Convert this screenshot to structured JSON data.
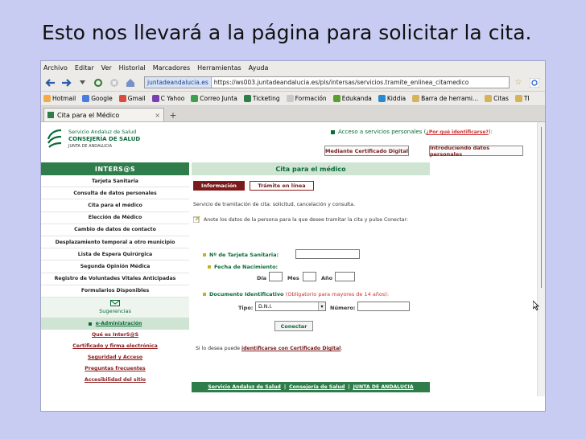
{
  "slide": {
    "title": "Esto nos llevará a la página para solicitar la cita."
  },
  "browser": {
    "menu": [
      "Archivo",
      "Editar",
      "Ver",
      "Historial",
      "Marcadores",
      "Herramientas",
      "Ayuda"
    ],
    "site_badge": "juntadeandalucia.es",
    "url": "https://ws003.juntadeandalucia.es/pls/intersas/servicios.tramite_enlinea_citamedico",
    "bookmarks": [
      "Hotmail",
      "Google",
      "Gmail",
      "C Yahoo",
      "Correo Junta",
      "Ticketing",
      "Formación",
      "Edukanda",
      "Kiddia",
      "Barra de herrami...",
      "Citas",
      "TI"
    ],
    "tab_title": "Cita para el Médico",
    "new_tab": "+",
    "tab_close": "×"
  },
  "header": {
    "logo_line1": "Servicio Andaluz de Salud",
    "logo_line2": "CONSEJERÍA DE SALUD",
    "logo_line3": "JUNTA DE ANDALUCIA",
    "access_text": "Acceso a servicios personales",
    "access_why": "¿Por qué identificarse?",
    "access_open": "(",
    "access_close": "):",
    "cert_button": "Mediante Certificado Digital",
    "data_button": "Introduciendo datos personales"
  },
  "sidebar": {
    "title": "INTERS@S",
    "items": [
      "Tarjeta Sanitaria",
      "Consulta de datos personales",
      "Cita para el médico",
      "Elección de Médico",
      "Cambio de datos de contacto",
      "Desplazamiento temporal a otro municipio",
      "Lista de Espera Quirúrgica",
      "Segunda Opinión Médica",
      "Registro de Voluntades Vitales Anticipadas",
      "Formularios Disponibles"
    ],
    "suggestions": "Sugerencias",
    "eadmin": "e-Administración",
    "links": [
      "Qué es InterS@S",
      "Certificado y firma electrónica",
      "Seguridad y Acceso",
      "Preguntas frecuentes",
      "Accesibilidad del sitio"
    ]
  },
  "main": {
    "title": "Cita para el médico",
    "tab_info": "Información",
    "tab_online": "Trámite en línea",
    "description": "Servicio de tramitación de cita: solicitud, cancelación y consulta.",
    "note": "Anote los datos de la persona para la que desee tramitar la cita y pulse Conectar:",
    "card_label": "Nº de Tarjeta Sanitaria:",
    "birth_label": "Fecha de Nacimiento:",
    "day": "Día",
    "month": "Mes",
    "year": "Año",
    "doc_label": "Documento Identificativo",
    "doc_note": "(Obligatorio para mayores de 14 años):",
    "type_label": "Tipo:",
    "type_value": "D.N.I.",
    "number_label": "Número:",
    "connect": "Conectar",
    "cert_prefix": "Si lo desea puede",
    "cert_link": "identificarse con Certificado Digital",
    "cert_suffix": "."
  },
  "footer": {
    "links": [
      "Servicio Andaluz de Salud",
      "Consejería de Salud",
      "JUNTA DE ANDALUCIA"
    ],
    "sep": "|"
  },
  "colors": {
    "green": "#2e7d4a",
    "maroon": "#7a1a1a",
    "light_green": "#cfe4d2",
    "slide_bg": "#c9ccf2"
  }
}
